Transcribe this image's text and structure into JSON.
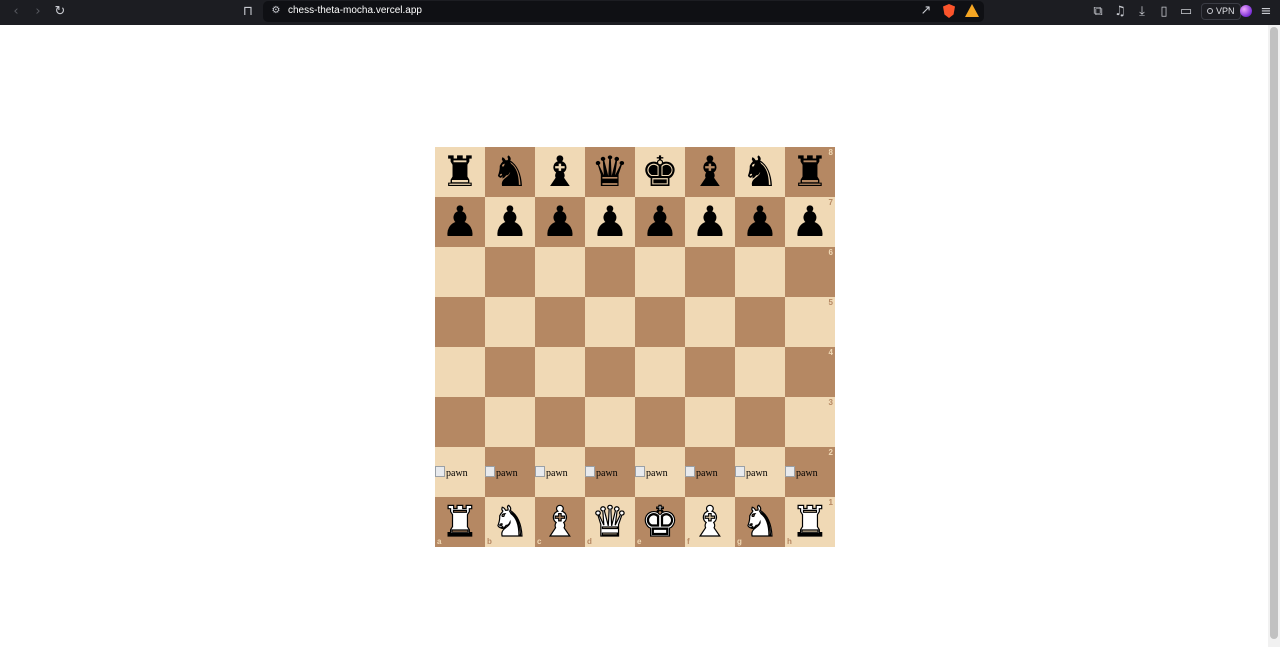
{
  "browser": {
    "url": "chess-theta-mocha.vercel.app",
    "vpn_label": "VPN"
  },
  "board": {
    "files": [
      "a",
      "b",
      "c",
      "d",
      "e",
      "f",
      "g",
      "h"
    ],
    "ranks": [
      "8",
      "7",
      "6",
      "5",
      "4",
      "3",
      "2",
      "1"
    ],
    "light_color": "#f0d9b5",
    "dark_color": "#b58863",
    "rows": [
      [
        "bR",
        "bN",
        "bB",
        "bQ",
        "bK",
        "bB",
        "bN",
        "bR"
      ],
      [
        "bP",
        "bP",
        "bP",
        "bP",
        "bP",
        "bP",
        "bP",
        "bP"
      ],
      [
        "",
        "",
        "",
        "",
        "",
        "",
        "",
        ""
      ],
      [
        "",
        "",
        "",
        "",
        "",
        "",
        "",
        ""
      ],
      [
        "",
        "",
        "",
        "",
        "",
        "",
        "",
        ""
      ],
      [
        "",
        "",
        "",
        "",
        "",
        "",
        "",
        ""
      ],
      [
        "wP",
        "wP",
        "wP",
        "wP",
        "wP",
        "wP",
        "wP",
        "wP"
      ],
      [
        "wR",
        "wN",
        "wB",
        "wQ",
        "wK",
        "wB",
        "wN",
        "wR"
      ]
    ],
    "broken_image_alt": "pawn"
  }
}
